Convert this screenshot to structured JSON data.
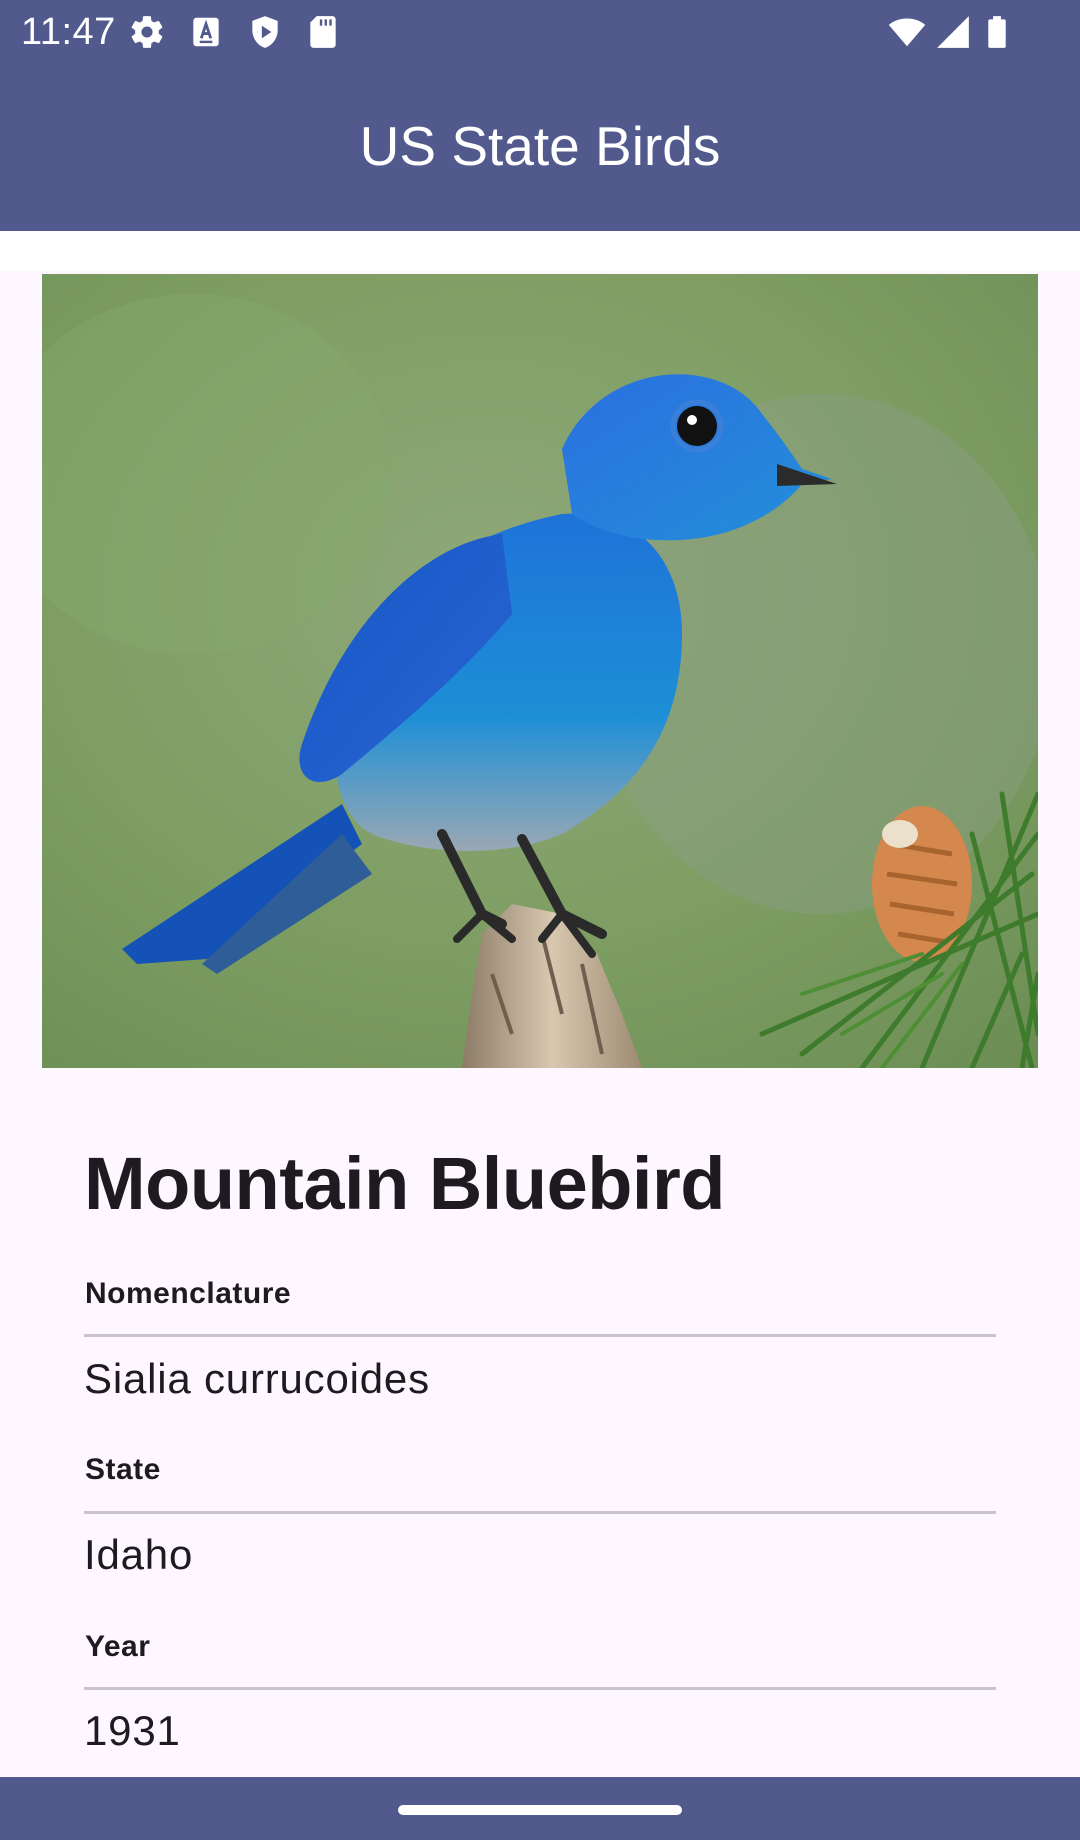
{
  "status_bar": {
    "time": "11:47",
    "left_icons": [
      "gear-icon",
      "keyboard-a-icon",
      "play-shield-icon",
      "sd-card-icon"
    ],
    "right_icons": [
      "wifi-icon",
      "signal-icon",
      "battery-icon"
    ]
  },
  "app_bar": {
    "title": "US State Birds",
    "color": "#525A8D"
  },
  "bird": {
    "name": "Mountain Bluebird",
    "fields": [
      {
        "label": "Nomenclature",
        "value": "Sialia currucoides"
      },
      {
        "label": "State",
        "value": "Idaho"
      },
      {
        "label": "Year",
        "value": "1931"
      }
    ]
  },
  "colors": {
    "primary": "#525A8D",
    "background": "#FEF7FF",
    "text": "#1D1B20",
    "divider": "#C7C5CA"
  }
}
